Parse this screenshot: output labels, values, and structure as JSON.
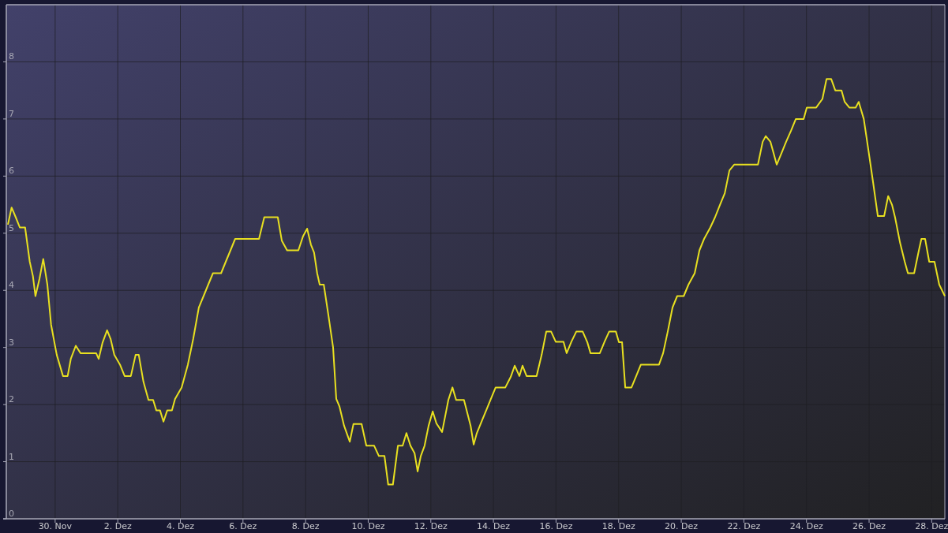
{
  "chart_data": {
    "type": "line",
    "grid": true,
    "x": [
      -1.51,
      -1.39,
      -1.26,
      -1.13,
      -0.96,
      -0.81,
      -0.71,
      -0.63,
      -0.5,
      -0.38,
      -0.25,
      -0.13,
      0.05,
      0.25,
      0.4,
      0.5,
      0.66,
      0.81,
      1.01,
      1.31,
      1.39,
      1.51,
      1.66,
      1.77,
      1.89,
      2.07,
      2.22,
      2.42,
      2.57,
      2.67,
      2.82,
      2.98,
      3.13,
      3.23,
      3.35,
      3.46,
      3.58,
      3.73,
      3.83,
      4.04,
      4.24,
      4.41,
      4.59,
      4.74,
      4.89,
      5.04,
      5.3,
      5.45,
      5.6,
      5.75,
      6.05,
      6.51,
      6.68,
      6.94,
      7.11,
      7.24,
      7.41,
      7.77,
      7.92,
      8.05,
      8.17,
      8.27,
      8.37,
      8.45,
      8.58,
      8.73,
      8.88,
      8.98,
      9.08,
      9.23,
      9.41,
      9.53,
      9.79,
      9.94,
      10.19,
      10.34,
      10.52,
      10.64,
      10.79,
      10.95,
      11.1,
      11.22,
      11.35,
      11.48,
      11.58,
      11.68,
      11.8,
      11.93,
      12.06,
      12.18,
      12.36,
      12.56,
      12.69,
      12.81,
      13.06,
      13.27,
      13.37,
      13.47,
      13.62,
      13.77,
      13.92,
      14.07,
      14.38,
      14.55,
      14.68,
      14.83,
      14.93,
      15.06,
      15.38,
      15.54,
      15.69,
      15.84,
      15.99,
      16.24,
      16.34,
      16.49,
      16.65,
      16.85,
      17.0,
      17.1,
      17.4,
      17.55,
      17.7,
      17.91,
      18.01,
      18.11,
      18.21,
      18.41,
      18.56,
      18.71,
      19.29,
      19.42,
      19.57,
      19.72,
      19.87,
      20.08,
      20.23,
      20.43,
      20.58,
      20.73,
      20.93,
      21.08,
      21.24,
      21.39,
      21.54,
      21.69,
      22.45,
      22.6,
      22.7,
      22.85,
      22.95,
      23.05,
      23.2,
      23.35,
      23.51,
      23.66,
      23.91,
      24.01,
      24.31,
      24.51,
      24.64,
      24.79,
      24.92,
      25.12,
      25.22,
      25.37,
      25.57,
      25.67,
      25.83,
      25.98,
      26.13,
      26.28,
      26.48,
      26.61,
      26.73,
      26.83,
      26.99,
      27.14,
      27.24,
      27.44,
      27.59,
      27.67,
      27.79,
      27.92,
      28.09,
      28.24,
      28.42
    ],
    "series": [
      {
        "color": "#e8e020",
        "values": [
          5.15,
          5.45,
          5.28,
          5.1,
          5.1,
          4.5,
          4.25,
          3.9,
          4.2,
          4.55,
          4.1,
          3.4,
          2.87,
          2.5,
          2.5,
          2.8,
          3.03,
          2.9,
          2.9,
          2.9,
          2.8,
          3.08,
          3.3,
          3.15,
          2.87,
          2.7,
          2.5,
          2.5,
          2.87,
          2.87,
          2.4,
          2.08,
          2.08,
          1.9,
          1.9,
          1.7,
          1.9,
          1.9,
          2.1,
          2.3,
          2.7,
          3.15,
          3.7,
          3.9,
          4.1,
          4.3,
          4.3,
          4.5,
          4.7,
          4.9,
          4.9,
          4.9,
          5.28,
          5.28,
          5.28,
          4.87,
          4.7,
          4.7,
          4.95,
          5.08,
          4.8,
          4.66,
          4.3,
          4.1,
          4.1,
          3.56,
          3.0,
          2.1,
          1.97,
          1.63,
          1.35,
          1.66,
          1.66,
          1.28,
          1.28,
          1.1,
          1.1,
          0.6,
          0.6,
          1.28,
          1.28,
          1.5,
          1.28,
          1.15,
          0.83,
          1.1,
          1.28,
          1.63,
          1.88,
          1.67,
          1.52,
          2.08,
          2.3,
          2.08,
          2.08,
          1.63,
          1.3,
          1.5,
          1.7,
          1.9,
          2.1,
          2.3,
          2.3,
          2.48,
          2.68,
          2.5,
          2.68,
          2.5,
          2.5,
          2.87,
          3.28,
          3.28,
          3.1,
          3.1,
          2.9,
          3.1,
          3.28,
          3.28,
          3.09,
          2.9,
          2.9,
          3.1,
          3.28,
          3.28,
          3.09,
          3.09,
          2.3,
          2.3,
          2.5,
          2.7,
          2.7,
          2.9,
          3.28,
          3.7,
          3.9,
          3.9,
          4.1,
          4.3,
          4.7,
          4.9,
          5.1,
          5.28,
          5.5,
          5.7,
          6.1,
          6.2,
          6.2,
          6.6,
          6.7,
          6.6,
          6.4,
          6.2,
          6.4,
          6.6,
          6.8,
          7.0,
          7.0,
          7.2,
          7.2,
          7.35,
          7.7,
          7.7,
          7.5,
          7.5,
          7.3,
          7.2,
          7.2,
          7.3,
          7.0,
          6.45,
          5.88,
          5.3,
          5.3,
          5.65,
          5.5,
          5.28,
          4.83,
          4.5,
          4.3,
          4.3,
          4.7,
          4.9,
          4.9,
          4.5,
          4.5,
          4.1,
          3.9
        ]
      }
    ],
    "xlim": [
      -1.56,
      28.42
    ],
    "ylim": [
      0,
      9
    ],
    "xticks": [
      {
        "value": 0,
        "label": "30. Nov"
      },
      {
        "value": 2,
        "label": "2. Dez"
      },
      {
        "value": 4,
        "label": "4. Dez"
      },
      {
        "value": 6,
        "label": "6. Dez"
      },
      {
        "value": 8,
        "label": "8. Dez"
      },
      {
        "value": 10,
        "label": "10. Dez"
      },
      {
        "value": 12,
        "label": "12. Dez"
      },
      {
        "value": 14,
        "label": "14. Dez"
      },
      {
        "value": 16,
        "label": "16. Dez"
      },
      {
        "value": 18,
        "label": "18. Dez"
      },
      {
        "value": 20,
        "label": "20. Dez"
      },
      {
        "value": 22,
        "label": "22. Dez"
      },
      {
        "value": 24,
        "label": "24. Dez"
      },
      {
        "value": 26,
        "label": "26. Dez"
      },
      {
        "value": 28,
        "label": "28. Dez"
      }
    ],
    "yticks": [
      0,
      1,
      2,
      3,
      4,
      5,
      6,
      7,
      8
    ]
  }
}
